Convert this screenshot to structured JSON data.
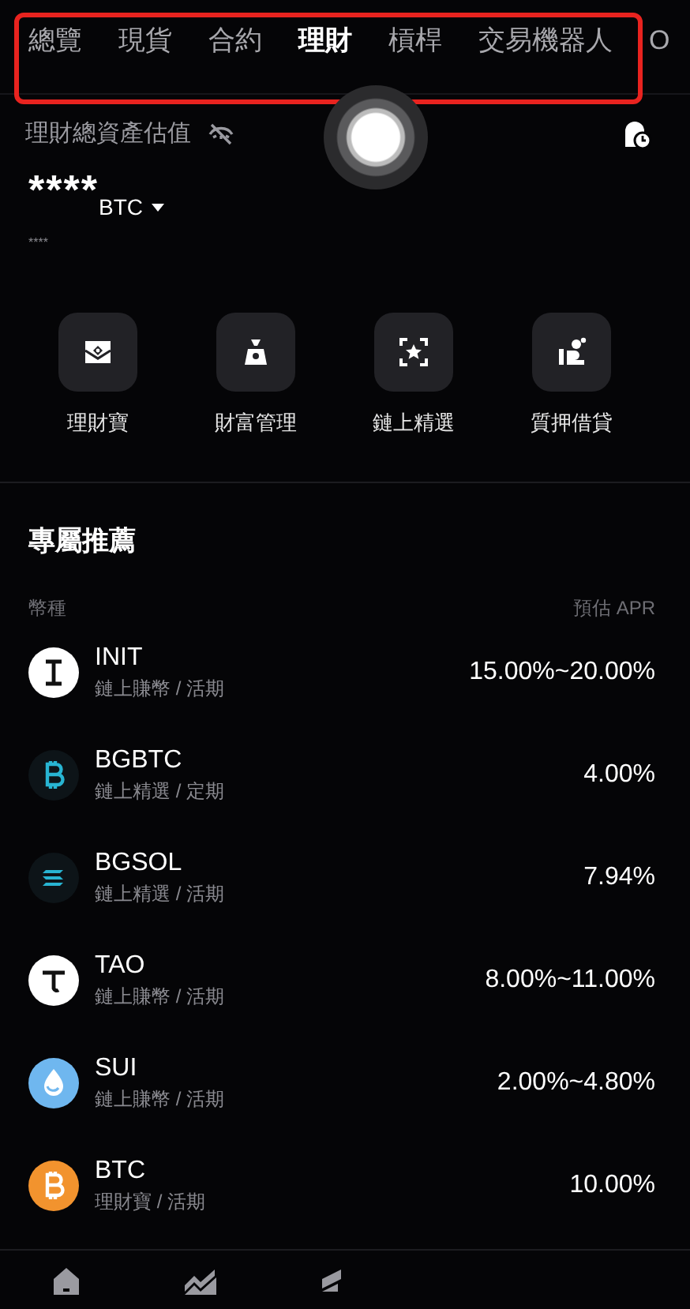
{
  "tabs": [
    {
      "label": "總覽",
      "selected": false
    },
    {
      "label": "現貨",
      "selected": false
    },
    {
      "label": "合約",
      "selected": false
    },
    {
      "label": "理財",
      "selected": true
    },
    {
      "label": "槓桿",
      "selected": false
    },
    {
      "label": "交易機器人",
      "selected": false
    },
    {
      "label": "O",
      "selected": false
    }
  ],
  "assets": {
    "label": "理財總資產估值",
    "value": "****",
    "currency": "BTC",
    "sub_value": "****"
  },
  "shortcuts": [
    {
      "label": "理財寶",
      "kind": "vault"
    },
    {
      "label": "財富管理",
      "kind": "bag"
    },
    {
      "label": "鏈上精選",
      "kind": "star"
    },
    {
      "label": "質押借貸",
      "kind": "loan"
    }
  ],
  "recommend": {
    "title": "專屬推薦",
    "columns": [
      "幣種",
      "預估 APR"
    ],
    "rows": [
      {
        "coin": "INIT",
        "desc": "鏈上賺幣 / 活期",
        "apr": "15.00%~20.00%",
        "kind": "init"
      },
      {
        "coin": "BGBTC",
        "desc": "鏈上精選 / 定期",
        "apr": "4.00%",
        "kind": "bgbtc"
      },
      {
        "coin": "BGSOL",
        "desc": "鏈上精選 / 活期",
        "apr": "7.94%",
        "kind": "bgsol"
      },
      {
        "coin": "TAO",
        "desc": "鏈上賺幣 / 活期",
        "apr": "8.00%~11.00%",
        "kind": "tao"
      },
      {
        "coin": "SUI",
        "desc": "鏈上賺幣 / 活期",
        "apr": "2.00%~4.80%",
        "kind": "sui"
      },
      {
        "coin": "BTC",
        "desc": "理財寶 / 活期",
        "apr": "10.00%",
        "kind": "btc"
      }
    ]
  }
}
